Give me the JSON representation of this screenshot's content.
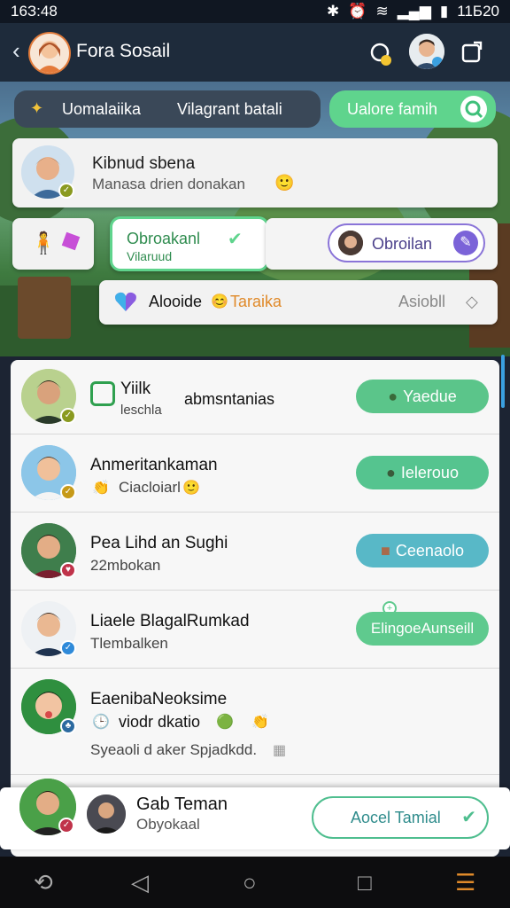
{
  "status_bar": {
    "time": "16З:48",
    "clock_right": "11Б20"
  },
  "header": {
    "title": "Fora Sosail"
  },
  "filters": {
    "chip1": "Uomalaiika",
    "chip2": "Vilagrant batali",
    "search_chip": "Ualore famih"
  },
  "top_card": {
    "name": "Kibnud sbena",
    "message": "Manasa drien donakan"
  },
  "mid_row": {
    "green_label": "Obroakanl",
    "green_sub": "Vilaruud",
    "purple_label": "Obroilan"
  },
  "tag_card": {
    "label": "Alooide",
    "tag": "Taraika",
    "right_text": "Asiobll"
  },
  "list": [
    {
      "name": "Yiilk",
      "sub": "leschla",
      "desc": "abmsntanias",
      "button": "Yaedue",
      "btn_color": "#5bc58a",
      "badge_color": "#8a9a20"
    },
    {
      "name": "Anmeritankaman",
      "sub": "Ciacloiarl",
      "desc": "",
      "button": "Ielerouo",
      "btn_color": "#55c48f",
      "badge_color": "#c79a18"
    },
    {
      "name": "Pea Lihd an Sughi",
      "sub": "22mbokan",
      "desc": "",
      "button": "Ceenaolo",
      "btn_color": "#58b8c7",
      "badge_color": "#c0334a"
    },
    {
      "name": "Liaele BlagalRumkad",
      "sub": "Tlembalken",
      "desc": "",
      "button": "ElingoeAunseill",
      "btn_color": "#5fca8e",
      "badge_color": "#2f8ad9"
    },
    {
      "name": "EaenibaNeoksime",
      "sub": "viodr dkatio",
      "desc": "Syeaoli d aker Spjadkdd.",
      "button": "",
      "btn_color": "",
      "badge_color": "#2c6aa0"
    }
  ],
  "footer": {
    "name": "Gab Teman",
    "sub": "Obyokaal",
    "button": "Aocel Tamial"
  }
}
